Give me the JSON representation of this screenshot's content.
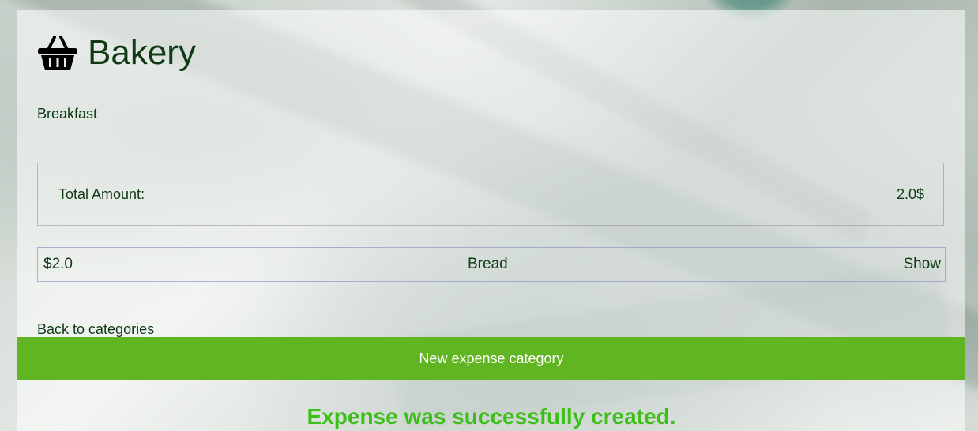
{
  "category": {
    "icon": "shopping-basket-icon",
    "title": "Bakery",
    "subtitle": "Breakfast"
  },
  "total": {
    "label": "Total Amount:",
    "value": "2.0$"
  },
  "expenses": [
    {
      "amount": "$2.0",
      "name": "Bread",
      "action": "Show"
    }
  ],
  "navigation": {
    "back_label": "Back to categories",
    "new_category_label": "New expense category"
  },
  "flash": {
    "message": "Expense was successfully created."
  },
  "colors": {
    "title_text": "#0f3b14",
    "button_bg": "#62b522",
    "flash_text": "#3cbf18"
  }
}
